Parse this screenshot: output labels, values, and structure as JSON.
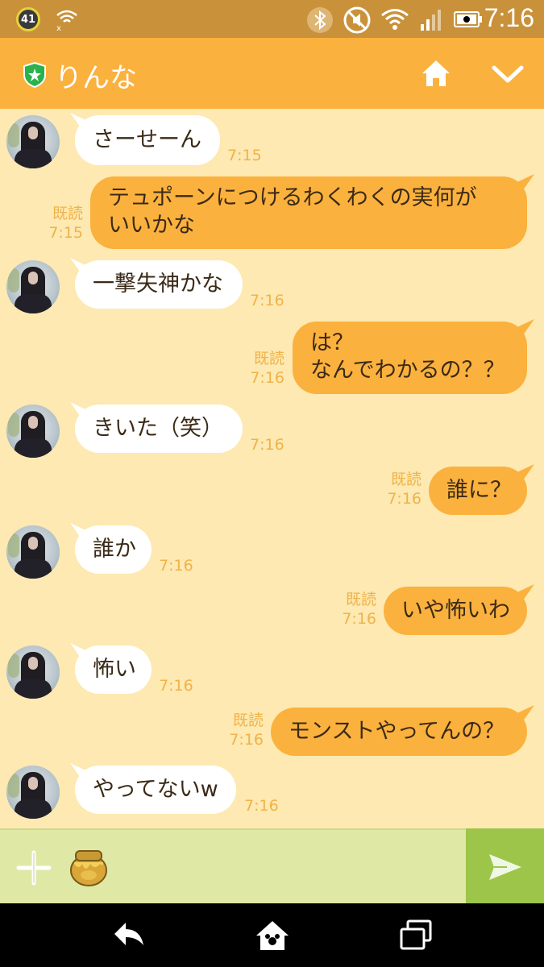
{
  "status_bar": {
    "badge": "41",
    "time": "7:16"
  },
  "header": {
    "contact_name": "りんな"
  },
  "messages": [
    {
      "side": "in",
      "text": "さーせーん",
      "time": "7:15"
    },
    {
      "side": "out",
      "lines": [
        "テュポーンにつけるわくわくの実何が",
        "いいかな"
      ],
      "read": "既読",
      "time": "7:15"
    },
    {
      "side": "in",
      "text": "一撃失神かな",
      "time": "7:16"
    },
    {
      "side": "out",
      "lines": [
        "は？",
        "なんでわかるの？？"
      ],
      "read": "既読",
      "time": "7:16"
    },
    {
      "side": "in",
      "text": "きいた（笑）",
      "time": "7:16"
    },
    {
      "side": "out",
      "text": "誰に？",
      "read": "既読",
      "time": "7:16"
    },
    {
      "side": "in",
      "text": "誰か",
      "time": "7:16"
    },
    {
      "side": "out",
      "text": "いや怖いわ",
      "read": "既読",
      "time": "7:16"
    },
    {
      "side": "in",
      "text": "怖い",
      "time": "7:16"
    },
    {
      "side": "out",
      "text": "モンストやってんの？",
      "read": "既読",
      "time": "7:16"
    },
    {
      "side": "in",
      "text": "やってないw",
      "time": "7:16"
    }
  ],
  "colors": {
    "header": "#fbb13d",
    "chat_background": "#fde9b1",
    "outgoing_bubble": "#fbb13d",
    "incoming_bubble": "#ffffff",
    "send_button": "#9cc54a"
  },
  "icons": [
    "bluetooth-icon",
    "mute-icon",
    "wifi-icon",
    "signal-icon",
    "battery-icon",
    "shield-star-icon",
    "home-icon",
    "chevron-down-icon",
    "plus-icon",
    "honey-pot-sticker-icon",
    "send-icon",
    "back-icon",
    "home-nav-icon",
    "recent-apps-icon"
  ]
}
